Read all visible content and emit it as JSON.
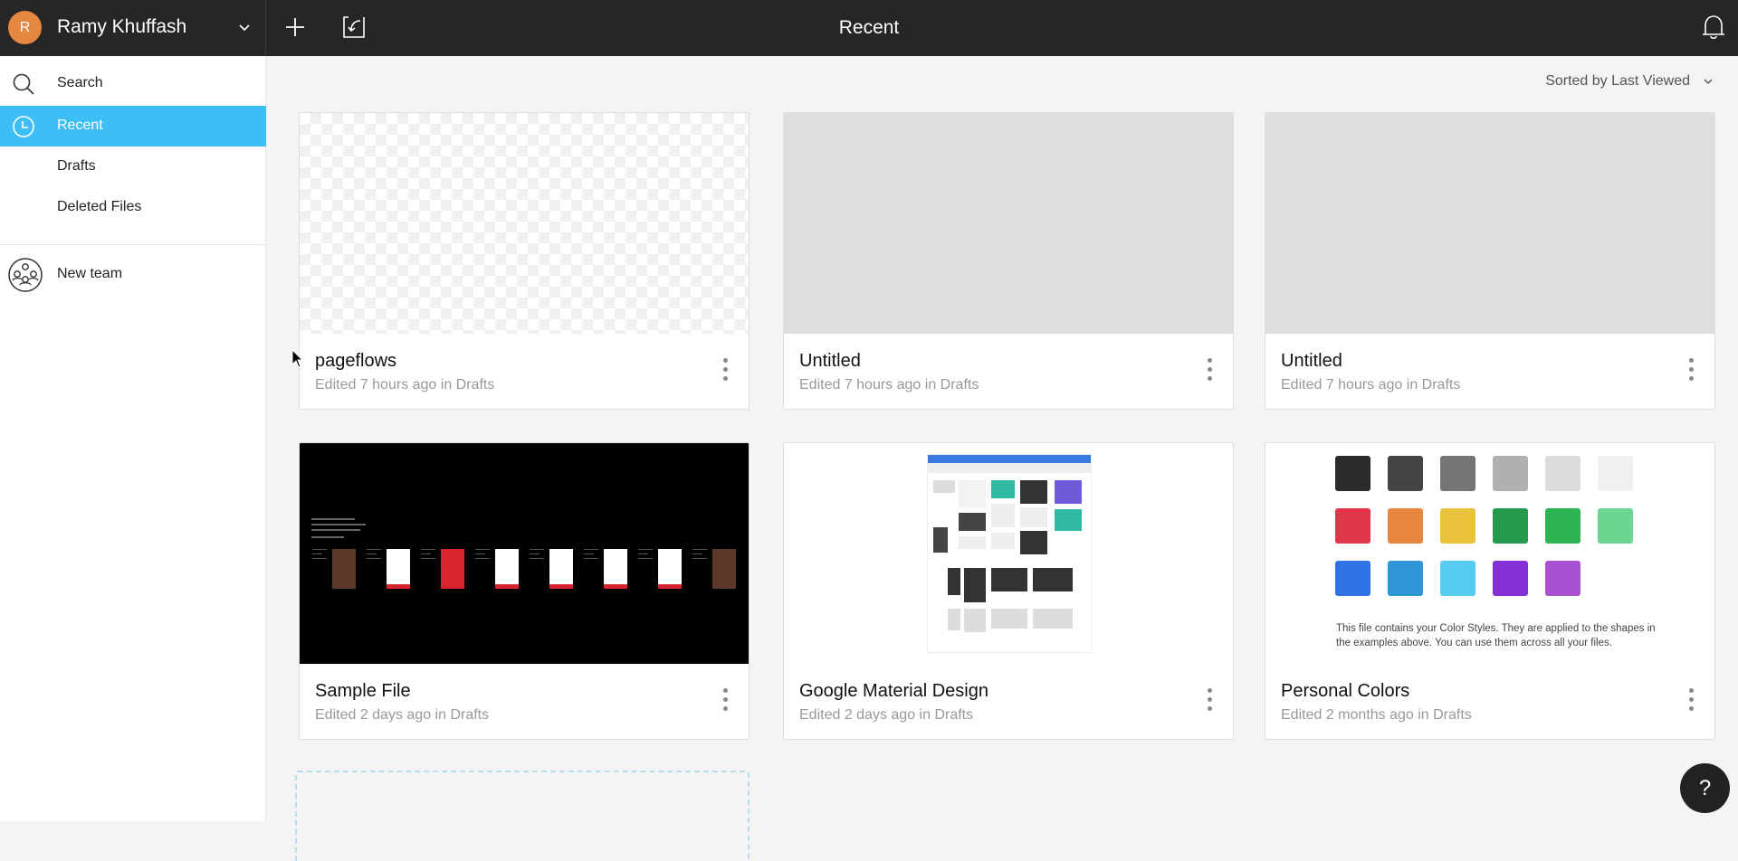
{
  "header": {
    "account": {
      "initial": "R",
      "name": "Ramy Khuffash",
      "avatar_color": "#e68740"
    },
    "title": "Recent",
    "icons": [
      "plus-icon",
      "import-icon",
      "bell-icon"
    ]
  },
  "sidebar": {
    "items": [
      {
        "label": "Search",
        "icon": "search-icon",
        "active": false
      },
      {
        "label": "Recent",
        "icon": "clock-icon",
        "active": true
      },
      {
        "label": "Drafts",
        "icon": null,
        "active": false
      },
      {
        "label": "Deleted Files",
        "icon": null,
        "active": false
      }
    ],
    "team": {
      "label": "New team",
      "icon": "team-icon"
    },
    "active_color": "#3dbef5"
  },
  "main": {
    "sort_label": "Sorted by Last Viewed",
    "files": [
      {
        "title": "pageflows",
        "subtitle": "Edited 7 hours ago in Drafts",
        "thumbnail": "transparent"
      },
      {
        "title": "Untitled",
        "subtitle": "Edited 7 hours ago in Drafts",
        "thumbnail": "blank"
      },
      {
        "title": "Untitled",
        "subtitle": "Edited 7 hours ago in Drafts",
        "thumbnail": "blank"
      },
      {
        "title": "Sample File",
        "subtitle": "Edited 2 days ago in Drafts",
        "thumbnail": "sample-file-preview"
      },
      {
        "title": "Google Material Design",
        "subtitle": "Edited 2 days ago in Drafts",
        "thumbnail": "material-design-preview"
      },
      {
        "title": "Personal Colors",
        "subtitle": "Edited 2 months ago in Drafts",
        "thumbnail": "color-styles-preview"
      }
    ],
    "personal_colors": {
      "swatches": [
        [
          "#2b2b2b",
          "#444444",
          "#757575",
          "#b0b0b0",
          "#dcdcdc",
          "#f0f0f0"
        ],
        [
          "#e0354a",
          "#e8873f",
          "#e9c23e",
          "#259a4a",
          "#2db553",
          "#6bd592"
        ],
        [
          "#2f72e4",
          "#2d95d5",
          "#56cdef",
          "#8430d6",
          "#aa50d3"
        ]
      ],
      "note": "This file contains your Color Styles. They are applied to the shapes in the examples above. You can use them across all your files."
    }
  },
  "help": {
    "label": "?"
  }
}
